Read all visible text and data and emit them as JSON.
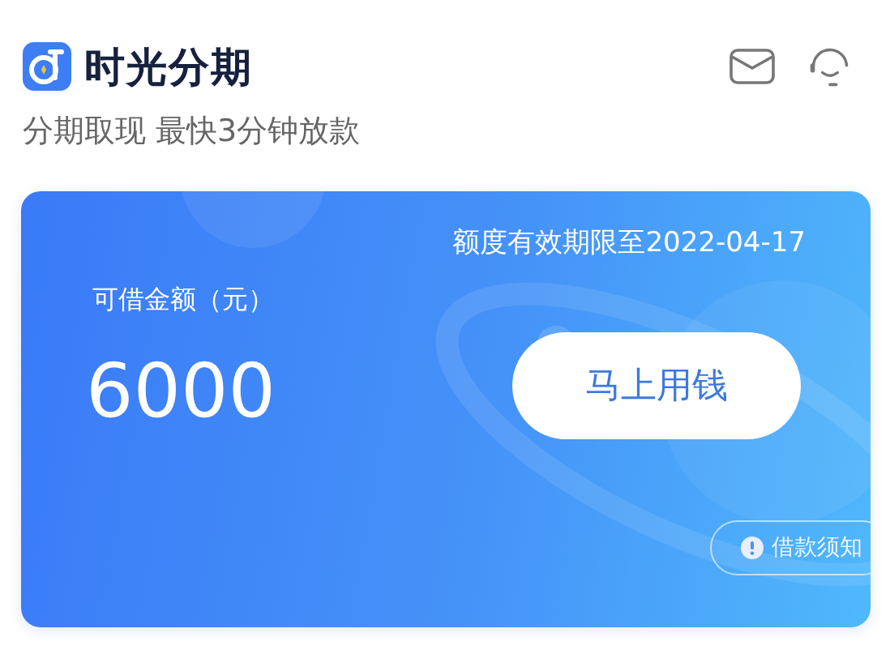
{
  "header": {
    "app_name": "时光分期",
    "tagline": "分期取现 最快3分钟放款"
  },
  "card": {
    "validity": "额度有效期限至2022-04-17",
    "amount_label": "可借金额（元）",
    "amount": "6000",
    "action_button": "马上用钱",
    "notice_button": "借款须知"
  }
}
